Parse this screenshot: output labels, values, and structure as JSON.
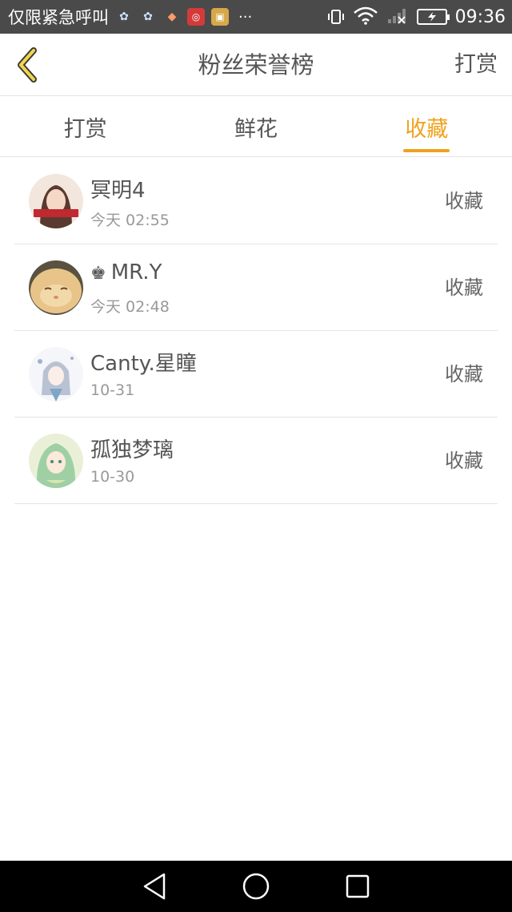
{
  "status_bar": {
    "carrier_text": "仅限紧急呼叫",
    "overflow": "···",
    "time": "09:36",
    "icons": [
      "flower-icon",
      "flower-icon",
      "kite-icon",
      "app-red-icon",
      "app-gold-icon",
      "vibrate-icon",
      "wifi-icon",
      "signal-icon",
      "battery-charging-icon"
    ]
  },
  "header": {
    "title": "粉丝荣誉榜",
    "right_action": "打赏"
  },
  "tabs": [
    {
      "label": "打赏",
      "active": false
    },
    {
      "label": "鲜花",
      "active": false
    },
    {
      "label": "收藏",
      "active": true
    }
  ],
  "colors": {
    "accent": "#f0a21e",
    "text": "#555555",
    "subtext": "#999999",
    "divider": "#e4e4e4",
    "status_bar": "#4a4a4a",
    "nav_bar": "#000000"
  },
  "fans": [
    {
      "name": "冥明4",
      "time": "今天 02:55",
      "action": "收藏",
      "crown": false
    },
    {
      "name": "MR.Y",
      "time": "今天 02:48",
      "action": "收藏",
      "crown": true
    },
    {
      "name": "Canty.星瞳",
      "time": "10-31",
      "action": "收藏",
      "crown": false
    },
    {
      "name": "孤独梦璃",
      "time": "10-30",
      "action": "收藏",
      "crown": false
    }
  ],
  "crown_glyph": "♚"
}
